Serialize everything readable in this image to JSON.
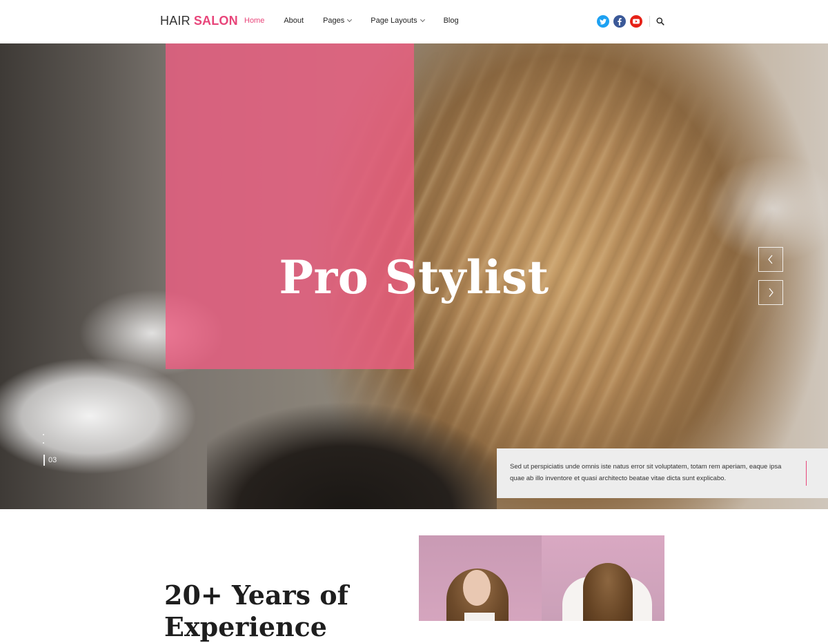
{
  "header": {
    "logo_part1": "HAIR",
    "logo_part2": "SALON",
    "nav": [
      {
        "label": "Home",
        "active": true
      },
      {
        "label": "About"
      },
      {
        "label": "Pages",
        "dropdown": true
      },
      {
        "label": "Page Layouts",
        "dropdown": true
      },
      {
        "label": "Blog"
      }
    ],
    "social": [
      "twitter-icon",
      "facebook-icon",
      "youtube-icon"
    ],
    "search_icon": "search-icon"
  },
  "hero": {
    "title": "Pro Stylist",
    "slide_number": "03",
    "caption": "Sed ut perspiciatis unde omnis iste natus error sit voluptatem, totam rem aperiam, eaque ipsa quae ab illo inventore et quasi architecto beatae vitae dicta sunt explicabo.",
    "prev_icon": "chevron-left-icon",
    "next_icon": "chevron-right-icon"
  },
  "about": {
    "heading": "20+ Years of Experience"
  },
  "colors": {
    "accent": "#e8457a",
    "overlay": "#f05c82",
    "caption_bg": "#ededed"
  }
}
